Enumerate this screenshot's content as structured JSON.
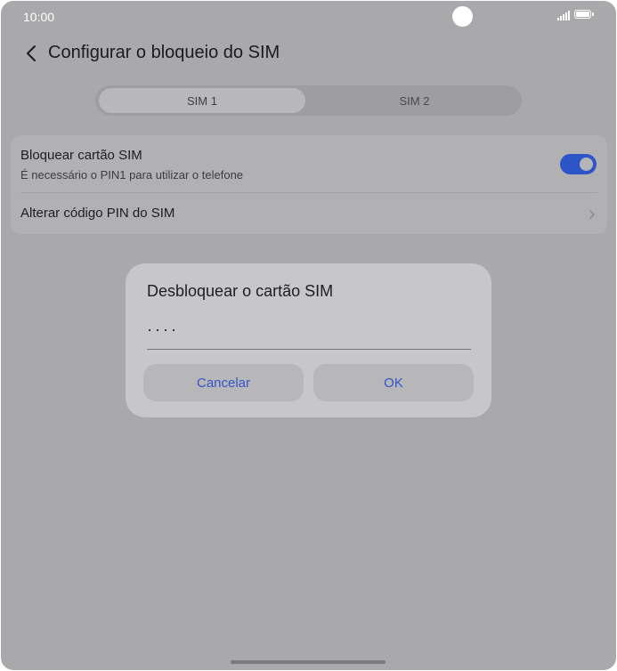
{
  "status_bar": {
    "time": "10:00",
    "icons": [
      "camera-cutout",
      "signal-icon",
      "battery-icon"
    ]
  },
  "header": {
    "title": "Configurar o bloqueio do SIM",
    "back_icon": "chevron-left-icon"
  },
  "tabs": [
    {
      "label": "SIM 1",
      "selected": true
    },
    {
      "label": "SIM 2",
      "selected": false
    }
  ],
  "settings": {
    "lock_sim": {
      "title": "Bloquear cartão SIM",
      "subtitle": "É necessário o PIN1 para utilizar o telefone",
      "enabled": true
    },
    "change_pin": {
      "title": "Alterar código PIN do SIM",
      "icon": "chevron-right-icon"
    }
  },
  "dialog": {
    "title": "Desbloquear o cartão SIM",
    "pin_value": "····",
    "cancel_label": "Cancelar",
    "ok_label": "OK"
  },
  "colors": {
    "accent": "#2d55c7",
    "button_text": "#3355c9",
    "overlay": "#a9a9ab"
  }
}
